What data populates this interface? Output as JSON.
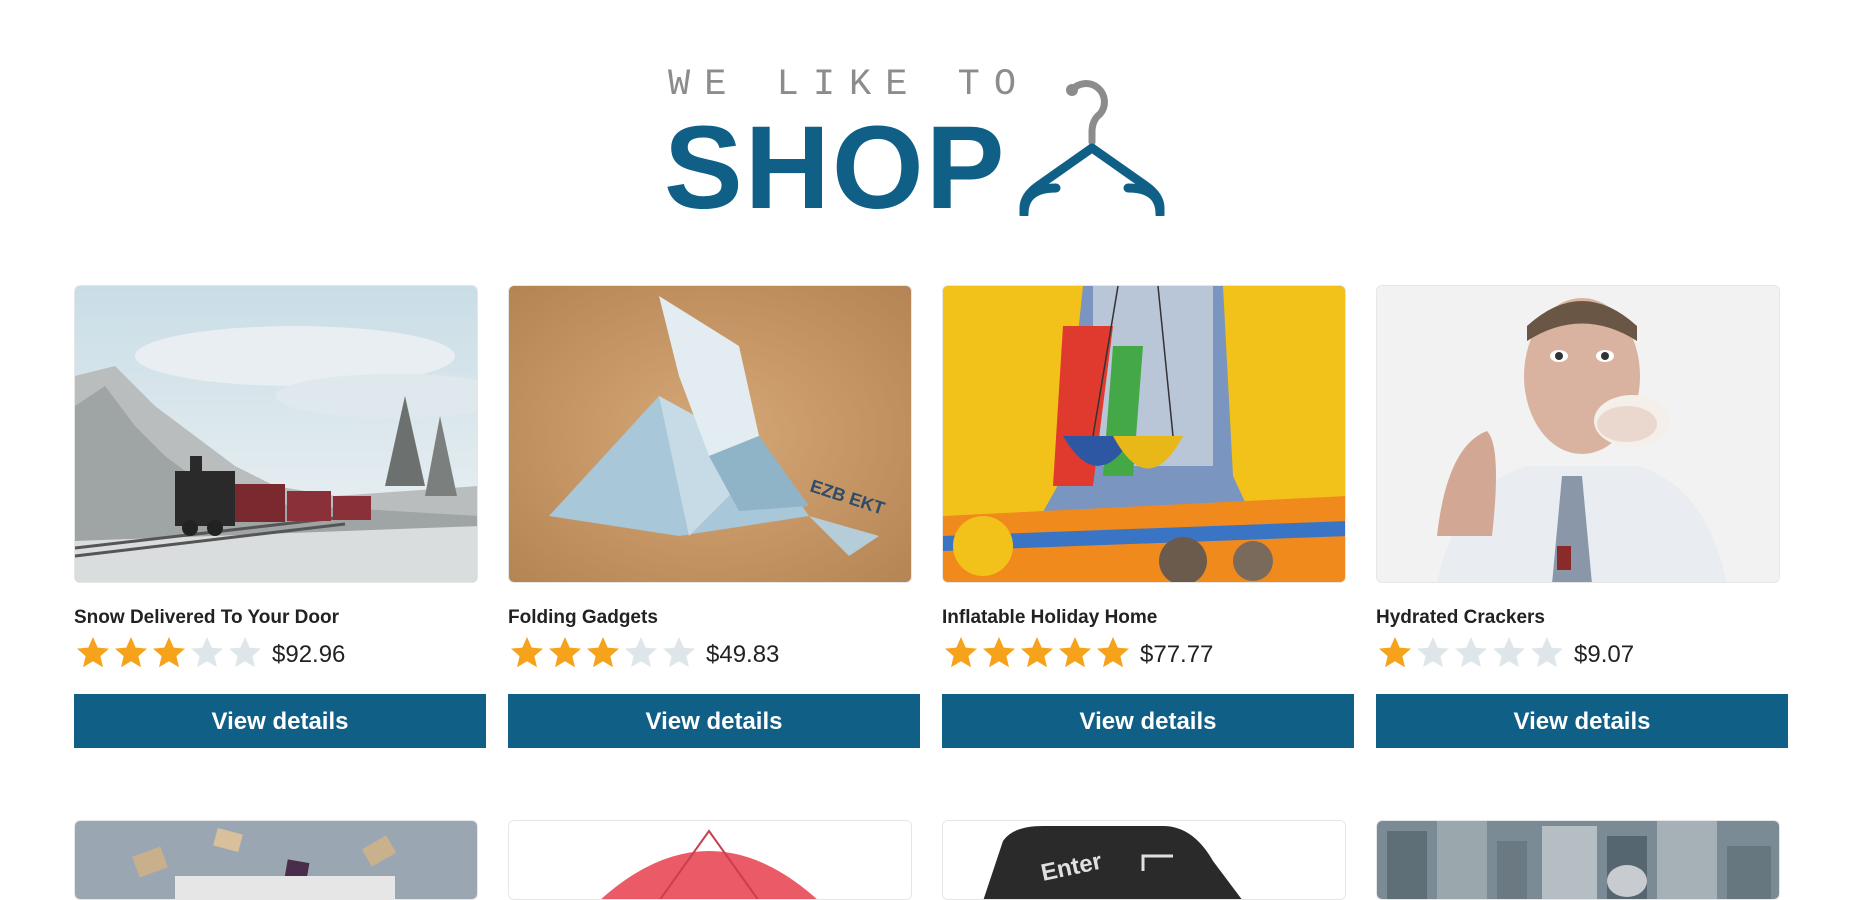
{
  "header": {
    "tagline": "WE LIKE TO",
    "brand": "SHOP",
    "icon": "hanger-icon"
  },
  "colors": {
    "brand": "#0f5f87",
    "tagline": "#8c8c8c",
    "star_filled": "#f7a21b",
    "star_empty": "#dfe6ea",
    "button": "#0f5f87"
  },
  "products": [
    {
      "title": "Snow Delivered To Your Door",
      "rating": 3,
      "rating_max": 5,
      "price": "$92.96",
      "button_label": "View details",
      "image": "snowy-train-photo"
    },
    {
      "title": "Folding Gadgets",
      "rating": 3,
      "rating_max": 5,
      "price": "$49.83",
      "button_label": "View details",
      "image": "origami-banknote-photo"
    },
    {
      "title": "Inflatable Holiday Home",
      "rating": 5,
      "rating_max": 5,
      "price": "$77.77",
      "button_label": "View details",
      "image": "bouncy-castle-photo"
    },
    {
      "title": "Hydrated Crackers",
      "rating": 1,
      "rating_max": 5,
      "price": "$9.07",
      "button_label": "View details",
      "image": "man-eating-cracker-photo"
    }
  ],
  "products_row2": [
    {
      "image": "flying-books-photo"
    },
    {
      "image": "red-umbrella-photo"
    },
    {
      "image": "enter-key-photo"
    },
    {
      "image": "city-skyline-photo"
    }
  ]
}
